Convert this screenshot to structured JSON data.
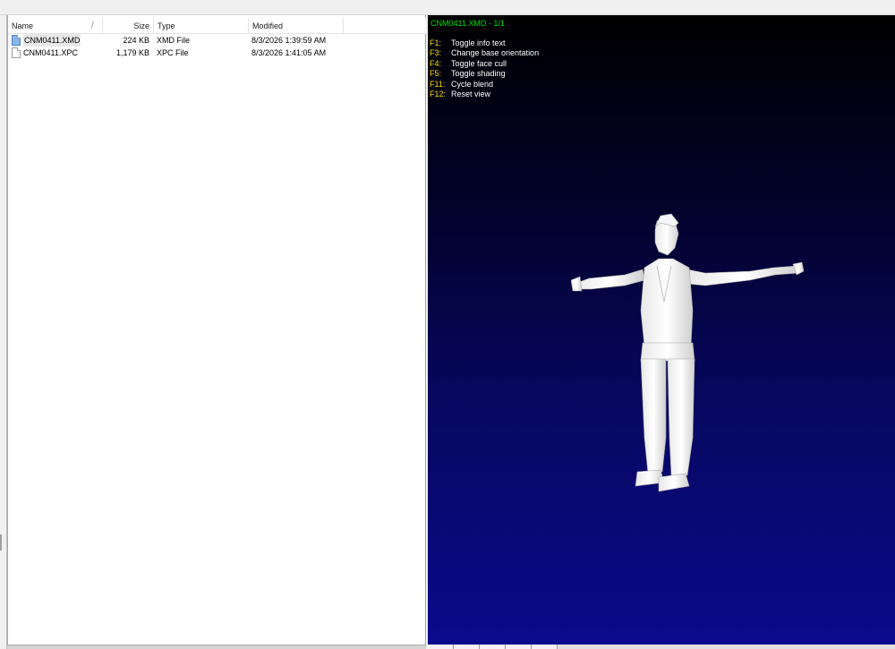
{
  "file_list": {
    "columns": {
      "name": "Name",
      "sort_indicator": "/",
      "size": "Size",
      "type": "Type",
      "modified": "Modified"
    },
    "files": [
      {
        "name": "CNM0411.XMD",
        "size": "224 KB",
        "type": "XMD File",
        "modified": "8/3/2026 1:39:59 AM",
        "icon": "blue-file-icon",
        "selected": true
      },
      {
        "name": "CNM0411.XPC",
        "size": "1,179 KB",
        "type": "XPC File",
        "modified": "8/3/2026 1:41:05 AM",
        "icon": "white-file-icon",
        "selected": false
      }
    ]
  },
  "viewer": {
    "title": "CNM0411.XMD - 1/1",
    "title_color": "#00e000",
    "key_color": "#ffd800",
    "help": [
      {
        "key": "F1:",
        "desc": "Toggle info text"
      },
      {
        "key": "F3:",
        "desc": "Change base orientation"
      },
      {
        "key": "F4:",
        "desc": "Toggle face cull"
      },
      {
        "key": "F5:",
        "desc": "Toggle shading"
      },
      {
        "key": "F11:",
        "desc": "Cycle blend"
      },
      {
        "key": "F12:",
        "desc": "Reset view"
      }
    ]
  }
}
